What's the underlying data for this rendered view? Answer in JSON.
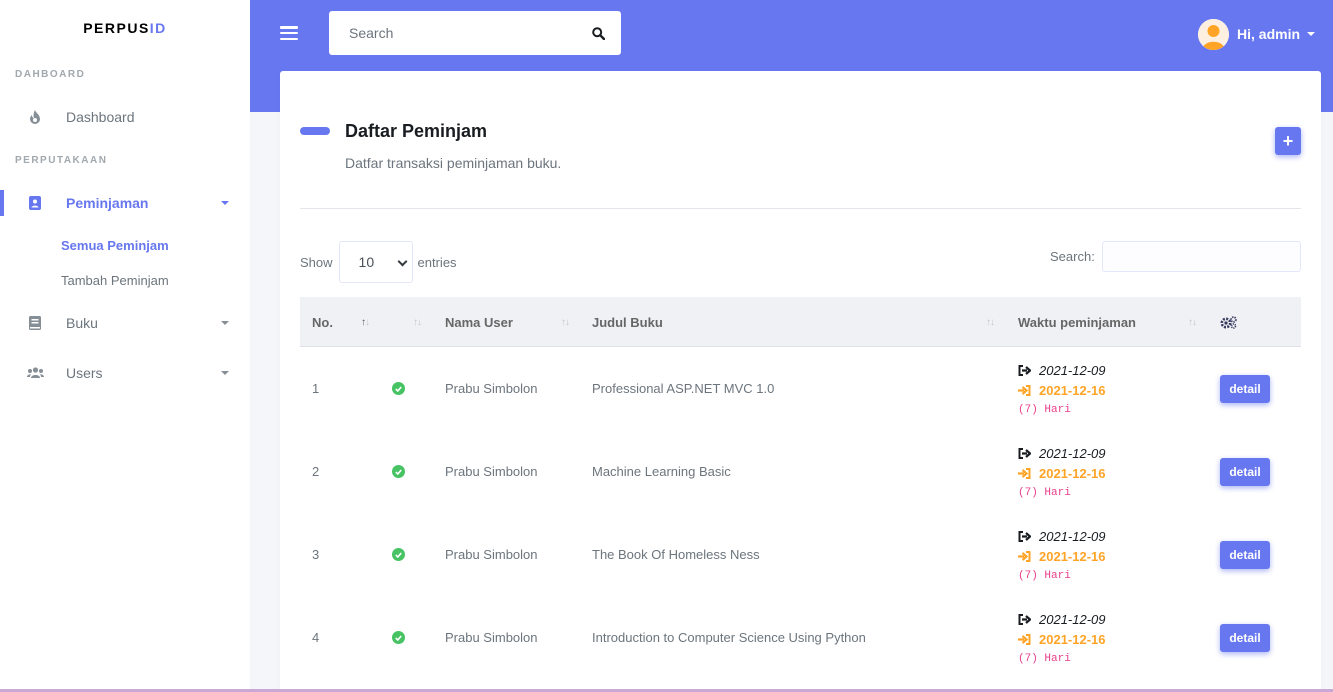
{
  "brand": {
    "part1": "PERPUS",
    "part2": "ID"
  },
  "sidebar": {
    "sections": [
      {
        "header": "DAHBOARD"
      },
      {
        "header": "PERPUTAKAAN"
      }
    ],
    "dashboard_label": "Dashboard",
    "peminjaman_label": "Peminjaman",
    "sub_all": "Semua Peminjam",
    "sub_add": "Tambah Peminjam",
    "buku_label": "Buku",
    "users_label": "Users"
  },
  "topbar": {
    "search_placeholder": "Search",
    "greeting": "Hi, admin"
  },
  "card": {
    "title": "Daftar Peminjam",
    "subtitle": "Datfar transaksi peminjaman buku.",
    "add_label": "+"
  },
  "table_controls": {
    "show_label": "Show",
    "entries_value": "10",
    "entries_label": "entries",
    "search_label": "Search:"
  },
  "table": {
    "headers": {
      "no": "No.",
      "user": "Nama User",
      "book": "Judul Buku",
      "time": "Waktu peminjaman"
    },
    "rows": [
      {
        "no": "1",
        "user": "Prabu Simbolon",
        "book": "Professional ASP.NET MVC 1.0",
        "borrow_date": "2021-12-09",
        "return_date": "2021-12-16",
        "days": "(7) Hari",
        "action": "detail"
      },
      {
        "no": "2",
        "user": "Prabu Simbolon",
        "book": "Machine Learning Basic",
        "borrow_date": "2021-12-09",
        "return_date": "2021-12-16",
        "days": "(7) Hari",
        "action": "detail"
      },
      {
        "no": "3",
        "user": "Prabu Simbolon",
        "book": "The Book Of Homeless Ness",
        "borrow_date": "2021-12-09",
        "return_date": "2021-12-16",
        "days": "(7) Hari",
        "action": "detail"
      },
      {
        "no": "4",
        "user": "Prabu Simbolon",
        "book": "Introduction to Computer Science Using Python",
        "borrow_date": "2021-12-09",
        "return_date": "2021-12-16",
        "days": "(7) Hari",
        "action": "detail"
      }
    ]
  },
  "colors": {
    "primary": "#6777ef",
    "success": "#47c363",
    "warning": "#ffa426",
    "pink": "#e83e8c"
  },
  "icons": {
    "menu": "hamburger-icon",
    "search": "search-icon",
    "dashboard": "fire-icon",
    "peminjaman": "id-badge-icon",
    "buku": "book-icon",
    "users": "users-icon",
    "settings": "cogs-icon",
    "status": "check-circle-icon",
    "borrow": "sign-out-icon",
    "return": "sign-in-icon"
  }
}
